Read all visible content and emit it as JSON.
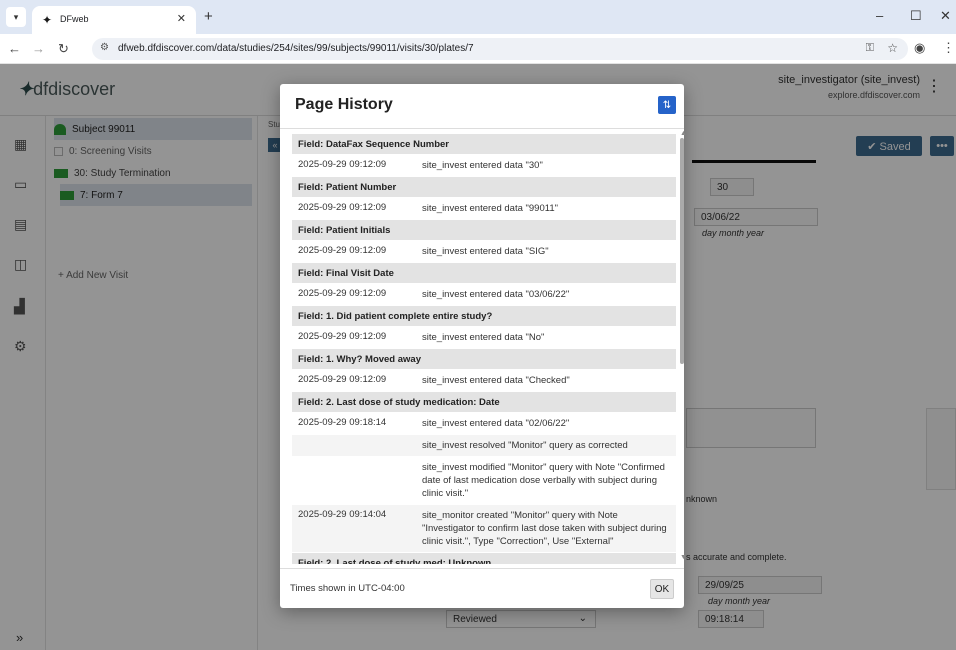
{
  "browser": {
    "tab_title": "DFweb",
    "url": "dfweb.dfdiscover.com/data/studies/254/sites/99/subjects/99011/visits/30/plates/7",
    "icons": [
      "tab-menu-icon",
      "favicon-icon",
      "close-icon",
      "new-tab-icon",
      "minimize-icon",
      "maximize-icon",
      "window-close-icon",
      "back-icon",
      "forward-icon",
      "reload-icon",
      "site-info-icon",
      "password-key-icon",
      "bookmark-star-icon",
      "profile-icon",
      "browser-menu-icon"
    ]
  },
  "app": {
    "logo": "dfdiscover",
    "user": {
      "name": "site_investigator (site_invest)",
      "site": "explore.dfdiscover.com"
    },
    "tree": {
      "subject": "Subject 99011",
      "items": [
        {
          "label": "0: Screening Visits",
          "color": "#cfcfcf"
        },
        {
          "label": "30: Study Termination",
          "color": "#2e9e3a"
        },
        {
          "label": "7: Form 7",
          "color": "#2e9e3a"
        }
      ],
      "add_visit": "+ Add New Visit"
    },
    "main": {
      "study_label": "Stu",
      "collapse": "«",
      "saved_label": "✔ Saved",
      "more_label": "•••",
      "value_30": "30",
      "date_value": "03/06/22",
      "date_sub": "day    month    year",
      "unknown": "nknown",
      "accurate": "s accurate and complete.",
      "sign_date": "29/09/25",
      "sign_sub": "day    month    year",
      "time": "09:18:14",
      "status_select": "Reviewed"
    }
  },
  "modal": {
    "title": "Page History",
    "footer_note": "Times shown in UTC-04:00",
    "ok_label": "OK",
    "history": [
      {
        "field": "Field: DataFax Sequence Number",
        "entries": [
          {
            "date": "2025-09-29 09:12:09",
            "action": "site_invest entered data \"30\""
          }
        ]
      },
      {
        "field": "Field: Patient Number",
        "entries": [
          {
            "date": "2025-09-29 09:12:09",
            "action": "site_invest entered data \"99011\""
          }
        ]
      },
      {
        "field": "Field: Patient Initials",
        "entries": [
          {
            "date": "2025-09-29 09:12:09",
            "action": "site_invest entered data \"SIG\""
          }
        ]
      },
      {
        "field": "Field: Final Visit Date",
        "entries": [
          {
            "date": "2025-09-29 09:12:09",
            "action": "site_invest entered data \"03/06/22\""
          }
        ]
      },
      {
        "field": "Field: 1. Did patient complete entire study?",
        "entries": [
          {
            "date": "2025-09-29 09:12:09",
            "action": "site_invest entered data \"No\""
          }
        ]
      },
      {
        "field": "Field: 1. Why? Moved away",
        "entries": [
          {
            "date": "2025-09-29 09:12:09",
            "action": "site_invest entered data \"Checked\""
          }
        ]
      },
      {
        "field": "Field: 2. Last dose of study medication: Date",
        "entries": [
          {
            "date": "2025-09-29 09:18:14",
            "action": "site_invest entered data \"02/06/22\""
          },
          {
            "date": "",
            "action": "site_invest resolved \"Monitor\" query as corrected"
          },
          {
            "date": "",
            "action": "site_invest modified \"Monitor\" query with Note \"Confirmed date of last medication dose verbally with subject during clinic visit.\""
          },
          {
            "date": "2025-09-29 09:14:04",
            "action": "site_monitor created \"Monitor\" query with Note \"Investigator to confirm last dose taken with subject during clinic visit.\", Type \"Correction\", Use \"External\""
          }
        ]
      },
      {
        "field": "Field: 2. Last dose of study med: Unknown",
        "entries": []
      }
    ]
  }
}
